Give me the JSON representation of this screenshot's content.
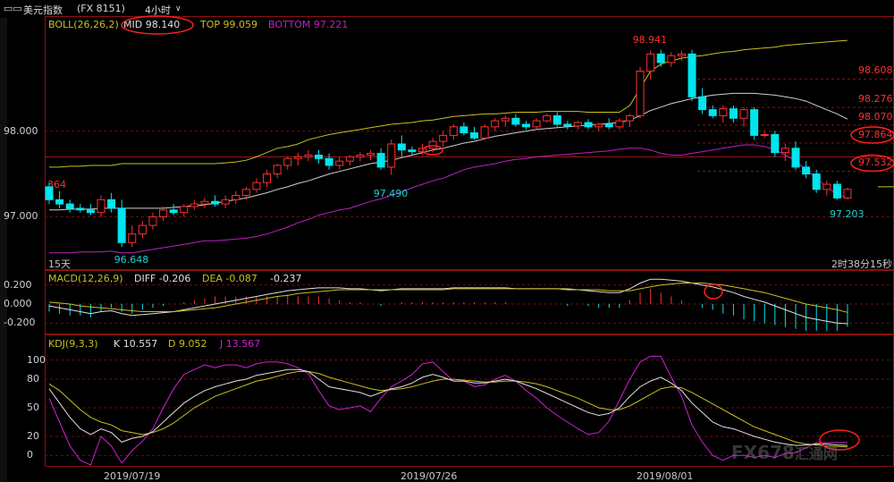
{
  "window": {
    "icon": "chart-window-icon",
    "title": "美元指数",
    "symbol": "(FX 8151)",
    "period": "4小时",
    "period_arrow": "chevron-down-icon"
  },
  "boll": {
    "label": "BOLL(26,26,2)",
    "mid": "MID 98.140",
    "top": "TOP 99.059",
    "bottom": "BOTTOM 97.221"
  },
  "macd": {
    "label": "MACD(12,26,9)",
    "diff": "DIFF -0.206",
    "dea": "DEA -0.087",
    "macd": "-0.237"
  },
  "kdj": {
    "label": "KDJ(9,3,3)",
    "k": "K 10.557",
    "d": "D 9.052",
    "j": "J 13.567"
  },
  "price_panel": {
    "y_ticks": [
      {
        "v": 98.0,
        "label": "98.000"
      },
      {
        "v": 97.0,
        "label": "97.000"
      }
    ],
    "right_levels": [
      {
        "v": 98.608,
        "label": "98.608"
      },
      {
        "v": 98.276,
        "label": "98.276"
      },
      {
        "v": 98.07,
        "label": "98.070"
      },
      {
        "v": 97.86,
        "label": "97.864",
        "circled": true
      },
      {
        "v": 97.532,
        "label": "97.532",
        "circled": true
      }
    ],
    "annotations": [
      {
        "label": "98.941",
        "color": "#ff3030",
        "v": 98.941
      },
      {
        "label": "97.490",
        "color": "#20d0d0",
        "v": 97.49
      },
      {
        "label": "96.648",
        "color": "#20d0d0",
        "v": 96.648
      },
      {
        "label": "97.203",
        "color": "#20d0d0",
        "v": 97.203
      }
    ],
    "left_cut_label": "364",
    "timeframe": "15天",
    "countdown": "2时38分15秒"
  },
  "macd_panel": {
    "y_ticks": [
      "0.200",
      "0.000",
      "-0.200"
    ]
  },
  "kdj_panel": {
    "y_ticks": [
      "100",
      "80",
      "50",
      "20",
      "0"
    ]
  },
  "x_axis": [
    "2019/07/19",
    "2019/07/26",
    "2019/08/01"
  ],
  "watermark": "FX678",
  "watermark_sub": "汇通网",
  "colors": {
    "up": "#ff3030",
    "down": "#00e5ee",
    "mid": "#d0d0d0",
    "top": "#c8c020",
    "bottom": "#c020c0",
    "k": "#e0e0e0",
    "d": "#c8c020",
    "j": "#d020d0",
    "border": "#8a1010"
  },
  "chart_data": {
    "type": "candlestick",
    "title": "美元指数 (FX 8151) 4小时",
    "price": {
      "ylim": [
        96.4,
        99.3
      ],
      "candles": [
        {
          "o": 97.35,
          "h": 97.4,
          "l": 97.15,
          "c": 97.2
        },
        {
          "o": 97.2,
          "h": 97.3,
          "l": 97.1,
          "c": 97.15
        },
        {
          "o": 97.15,
          "h": 97.2,
          "l": 97.05,
          "c": 97.1
        },
        {
          "o": 97.1,
          "h": 97.15,
          "l": 97.05,
          "c": 97.08
        },
        {
          "o": 97.08,
          "h": 97.15,
          "l": 97.02,
          "c": 97.05
        },
        {
          "o": 97.05,
          "h": 97.25,
          "l": 97.0,
          "c": 97.2
        },
        {
          "o": 97.2,
          "h": 97.28,
          "l": 97.05,
          "c": 97.1
        },
        {
          "o": 97.1,
          "h": 97.2,
          "l": 96.65,
          "c": 96.7
        },
        {
          "o": 96.7,
          "h": 96.9,
          "l": 96.648,
          "c": 96.8
        },
        {
          "o": 96.8,
          "h": 96.95,
          "l": 96.75,
          "c": 96.9
        },
        {
          "o": 96.9,
          "h": 97.05,
          "l": 96.85,
          "c": 97.0
        },
        {
          "o": 97.0,
          "h": 97.12,
          "l": 96.95,
          "c": 97.08
        },
        {
          "o": 97.08,
          "h": 97.15,
          "l": 97.02,
          "c": 97.05
        },
        {
          "o": 97.05,
          "h": 97.15,
          "l": 97.0,
          "c": 97.12
        },
        {
          "o": 97.12,
          "h": 97.2,
          "l": 97.08,
          "c": 97.15
        },
        {
          "o": 97.15,
          "h": 97.22,
          "l": 97.1,
          "c": 97.18
        },
        {
          "o": 97.18,
          "h": 97.25,
          "l": 97.12,
          "c": 97.15
        },
        {
          "o": 97.15,
          "h": 97.25,
          "l": 97.1,
          "c": 97.2
        },
        {
          "o": 97.2,
          "h": 97.3,
          "l": 97.15,
          "c": 97.25
        },
        {
          "o": 97.25,
          "h": 97.35,
          "l": 97.2,
          "c": 97.32
        },
        {
          "o": 97.32,
          "h": 97.45,
          "l": 97.28,
          "c": 97.4
        },
        {
          "o": 97.4,
          "h": 97.55,
          "l": 97.35,
          "c": 97.5
        },
        {
          "o": 97.5,
          "h": 97.62,
          "l": 97.45,
          "c": 97.6
        },
        {
          "o": 97.6,
          "h": 97.7,
          "l": 97.55,
          "c": 97.68
        },
        {
          "o": 97.68,
          "h": 97.75,
          "l": 97.6,
          "c": 97.7
        },
        {
          "o": 97.7,
          "h": 97.78,
          "l": 97.65,
          "c": 97.72
        },
        {
          "o": 97.72,
          "h": 97.78,
          "l": 97.62,
          "c": 97.68
        },
        {
          "o": 97.68,
          "h": 97.74,
          "l": 97.55,
          "c": 97.6
        },
        {
          "o": 97.6,
          "h": 97.7,
          "l": 97.55,
          "c": 97.65
        },
        {
          "o": 97.65,
          "h": 97.72,
          "l": 97.6,
          "c": 97.7
        },
        {
          "o": 97.7,
          "h": 97.76,
          "l": 97.65,
          "c": 97.72
        },
        {
          "o": 97.72,
          "h": 97.78,
          "l": 97.66,
          "c": 97.74
        },
        {
          "o": 97.74,
          "h": 97.8,
          "l": 97.55,
          "c": 97.58
        },
        {
          "o": 97.58,
          "h": 97.9,
          "l": 97.49,
          "c": 97.85
        },
        {
          "o": 97.85,
          "h": 97.95,
          "l": 97.7,
          "c": 97.78
        },
        {
          "o": 97.78,
          "h": 97.82,
          "l": 97.72,
          "c": 97.76
        },
        {
          "o": 97.76,
          "h": 97.85,
          "l": 97.72,
          "c": 97.8
        },
        {
          "o": 97.8,
          "h": 97.92,
          "l": 97.75,
          "c": 97.88
        },
        {
          "o": 97.88,
          "h": 98.0,
          "l": 97.82,
          "c": 97.95
        },
        {
          "o": 97.95,
          "h": 98.08,
          "l": 97.9,
          "c": 98.05
        },
        {
          "o": 98.05,
          "h": 98.1,
          "l": 97.95,
          "c": 97.98
        },
        {
          "o": 97.98,
          "h": 98.05,
          "l": 97.9,
          "c": 97.92
        },
        {
          "o": 97.92,
          "h": 98.08,
          "l": 97.9,
          "c": 98.05
        },
        {
          "o": 98.05,
          "h": 98.15,
          "l": 98.0,
          "c": 98.12
        },
        {
          "o": 98.12,
          "h": 98.18,
          "l": 98.05,
          "c": 98.15
        },
        {
          "o": 98.15,
          "h": 98.2,
          "l": 98.05,
          "c": 98.08
        },
        {
          "o": 98.08,
          "h": 98.12,
          "l": 98.02,
          "c": 98.05
        },
        {
          "o": 98.05,
          "h": 98.15,
          "l": 98.02,
          "c": 98.12
        },
        {
          "o": 98.12,
          "h": 98.2,
          "l": 98.1,
          "c": 98.18
        },
        {
          "o": 98.18,
          "h": 98.22,
          "l": 98.05,
          "c": 98.08
        },
        {
          "o": 98.08,
          "h": 98.12,
          "l": 98.02,
          "c": 98.06
        },
        {
          "o": 98.06,
          "h": 98.12,
          "l": 98.02,
          "c": 98.1
        },
        {
          "o": 98.1,
          "h": 98.14,
          "l": 98.02,
          "c": 98.05
        },
        {
          "o": 98.05,
          "h": 98.1,
          "l": 98.0,
          "c": 98.08
        },
        {
          "o": 98.08,
          "h": 98.15,
          "l": 98.02,
          "c": 98.05
        },
        {
          "o": 98.05,
          "h": 98.15,
          "l": 98.02,
          "c": 98.12
        },
        {
          "o": 98.12,
          "h": 98.2,
          "l": 98.05,
          "c": 98.18
        },
        {
          "o": 98.18,
          "h": 98.75,
          "l": 98.15,
          "c": 98.7
        },
        {
          "o": 98.7,
          "h": 98.941,
          "l": 98.6,
          "c": 98.9
        },
        {
          "o": 98.9,
          "h": 98.95,
          "l": 98.75,
          "c": 98.8
        },
        {
          "o": 98.8,
          "h": 98.92,
          "l": 98.75,
          "c": 98.88
        },
        {
          "o": 98.88,
          "h": 98.94,
          "l": 98.82,
          "c": 98.9
        },
        {
          "o": 98.9,
          "h": 98.95,
          "l": 98.35,
          "c": 98.4
        },
        {
          "o": 98.4,
          "h": 98.5,
          "l": 98.2,
          "c": 98.25
        },
        {
          "o": 98.25,
          "h": 98.3,
          "l": 98.15,
          "c": 98.18
        },
        {
          "o": 98.18,
          "h": 98.3,
          "l": 98.1,
          "c": 98.26
        },
        {
          "o": 98.26,
          "h": 98.3,
          "l": 98.1,
          "c": 98.15
        },
        {
          "o": 98.15,
          "h": 98.28,
          "l": 98.05,
          "c": 98.25
        },
        {
          "o": 98.25,
          "h": 98.28,
          "l": 97.9,
          "c": 97.95
        },
        {
          "o": 97.95,
          "h": 98.0,
          "l": 97.92,
          "c": 97.96
        },
        {
          "o": 97.96,
          "h": 98.0,
          "l": 97.7,
          "c": 97.75
        },
        {
          "o": 97.75,
          "h": 97.85,
          "l": 97.65,
          "c": 97.8
        },
        {
          "o": 97.8,
          "h": 97.88,
          "l": 97.55,
          "c": 97.58
        },
        {
          "o": 97.58,
          "h": 97.65,
          "l": 97.45,
          "c": 97.5
        },
        {
          "o": 97.5,
          "h": 97.55,
          "l": 97.28,
          "c": 97.32
        },
        {
          "o": 97.32,
          "h": 97.42,
          "l": 97.25,
          "c": 97.38
        },
        {
          "o": 97.38,
          "h": 97.42,
          "l": 97.2,
          "c": 97.22
        },
        {
          "o": 97.22,
          "h": 97.34,
          "l": 97.203,
          "c": 97.32
        }
      ],
      "boll_top": [
        97.58,
        97.58,
        97.59,
        97.59,
        97.6,
        97.6,
        97.6,
        97.62,
        97.62,
        97.62,
        97.62,
        97.62,
        97.62,
        97.62,
        97.62,
        97.62,
        97.62,
        97.63,
        97.64,
        97.66,
        97.7,
        97.75,
        97.8,
        97.82,
        97.85,
        97.9,
        97.93,
        97.96,
        97.98,
        98.0,
        98.02,
        98.04,
        98.06,
        98.08,
        98.09,
        98.1,
        98.12,
        98.13,
        98.15,
        98.17,
        98.18,
        98.19,
        98.2,
        98.2,
        98.21,
        98.22,
        98.22,
        98.22,
        98.23,
        98.23,
        98.23,
        98.23,
        98.22,
        98.22,
        98.22,
        98.22,
        98.3,
        98.5,
        98.7,
        98.78,
        98.82,
        98.85,
        98.87,
        98.88,
        98.9,
        98.92,
        98.93,
        98.95,
        98.96,
        98.97,
        98.98,
        99.0,
        99.01,
        99.02,
        99.03,
        99.04,
        99.05,
        99.059
      ],
      "boll_mid": [
        97.08,
        97.08,
        97.09,
        97.09,
        97.09,
        97.1,
        97.1,
        97.1,
        97.1,
        97.1,
        97.1,
        97.1,
        97.11,
        97.12,
        97.13,
        97.14,
        97.16,
        97.18,
        97.2,
        97.22,
        97.25,
        97.28,
        97.32,
        97.35,
        97.39,
        97.42,
        97.46,
        97.5,
        97.53,
        97.56,
        97.59,
        97.62,
        97.64,
        97.66,
        97.69,
        97.72,
        97.75,
        97.78,
        97.8,
        97.83,
        97.86,
        97.88,
        97.91,
        97.94,
        97.96,
        97.98,
        98.0,
        98.02,
        98.03,
        98.04,
        98.05,
        98.06,
        98.07,
        98.08,
        98.09,
        98.1,
        98.13,
        98.18,
        98.24,
        98.28,
        98.32,
        98.35,
        98.38,
        98.4,
        98.42,
        98.43,
        98.44,
        98.44,
        98.44,
        98.43,
        98.42,
        98.4,
        98.38,
        98.35,
        98.3,
        98.25,
        98.2,
        98.14
      ],
      "boll_bottom": [
        96.58,
        96.58,
        96.58,
        96.59,
        96.59,
        96.59,
        96.6,
        96.58,
        96.58,
        96.6,
        96.62,
        96.64,
        96.66,
        96.68,
        96.7,
        96.72,
        96.72,
        96.73,
        96.74,
        96.75,
        96.77,
        96.8,
        96.84,
        96.88,
        96.93,
        96.97,
        97.02,
        97.05,
        97.08,
        97.1,
        97.14,
        97.18,
        97.21,
        97.25,
        97.29,
        97.34,
        97.38,
        97.42,
        97.45,
        97.5,
        97.55,
        97.58,
        97.6,
        97.62,
        97.65,
        97.67,
        97.68,
        97.7,
        97.71,
        97.72,
        97.73,
        97.74,
        97.75,
        97.76,
        97.77,
        97.79,
        97.8,
        97.8,
        97.78,
        97.74,
        97.72,
        97.72,
        97.74,
        97.76,
        97.78,
        97.8,
        97.82,
        97.84,
        97.84,
        97.82,
        97.78,
        97.72,
        97.65,
        97.55,
        97.45,
        97.35,
        97.26,
        97.221
      ]
    },
    "macd": {
      "ylim": [
        -0.3,
        0.3
      ],
      "diff": [
        -0.02,
        -0.04,
        -0.06,
        -0.08,
        -0.1,
        -0.08,
        -0.07,
        -0.1,
        -0.12,
        -0.11,
        -0.1,
        -0.09,
        -0.08,
        -0.06,
        -0.04,
        -0.02,
        0.0,
        0.02,
        0.04,
        0.06,
        0.08,
        0.1,
        0.12,
        0.14,
        0.15,
        0.16,
        0.17,
        0.17,
        0.17,
        0.16,
        0.16,
        0.15,
        0.14,
        0.15,
        0.16,
        0.16,
        0.16,
        0.16,
        0.16,
        0.17,
        0.17,
        0.17,
        0.17,
        0.17,
        0.17,
        0.16,
        0.16,
        0.16,
        0.16,
        0.16,
        0.15,
        0.15,
        0.14,
        0.13,
        0.12,
        0.12,
        0.16,
        0.22,
        0.26,
        0.26,
        0.25,
        0.24,
        0.22,
        0.2,
        0.18,
        0.15,
        0.12,
        0.08,
        0.05,
        0.02,
        -0.02,
        -0.06,
        -0.1,
        -0.14,
        -0.16,
        -0.18,
        -0.2,
        -0.206
      ],
      "dea": [
        0.02,
        0.01,
        0.0,
        -0.02,
        -0.03,
        -0.04,
        -0.05,
        -0.06,
        -0.07,
        -0.08,
        -0.08,
        -0.08,
        -0.08,
        -0.07,
        -0.06,
        -0.05,
        -0.04,
        -0.02,
        0.0,
        0.02,
        0.04,
        0.06,
        0.08,
        0.09,
        0.11,
        0.12,
        0.13,
        0.14,
        0.15,
        0.15,
        0.15,
        0.15,
        0.15,
        0.15,
        0.15,
        0.15,
        0.15,
        0.15,
        0.15,
        0.16,
        0.16,
        0.16,
        0.16,
        0.16,
        0.16,
        0.16,
        0.16,
        0.16,
        0.16,
        0.16,
        0.16,
        0.15,
        0.15,
        0.15,
        0.14,
        0.14,
        0.14,
        0.16,
        0.18,
        0.2,
        0.21,
        0.22,
        0.22,
        0.22,
        0.21,
        0.2,
        0.18,
        0.16,
        0.14,
        0.12,
        0.09,
        0.06,
        0.03,
        0.0,
        -0.02,
        -0.04,
        -0.06,
        -0.087
      ]
    },
    "kdj": {
      "ylim": [
        -10,
        110
      ],
      "k": [
        70,
        55,
        40,
        28,
        22,
        28,
        24,
        14,
        18,
        20,
        25,
        35,
        45,
        55,
        62,
        68,
        72,
        75,
        78,
        80,
        84,
        86,
        88,
        90,
        90,
        88,
        80,
        72,
        70,
        68,
        66,
        62,
        66,
        70,
        72,
        76,
        82,
        85,
        82,
        78,
        78,
        76,
        76,
        78,
        80,
        78,
        74,
        70,
        65,
        60,
        55,
        50,
        45,
        42,
        44,
        50,
        62,
        72,
        78,
        82,
        76,
        68,
        55,
        45,
        35,
        30,
        28,
        24,
        20,
        17,
        14,
        12,
        10.557,
        11,
        12,
        12,
        11,
        10.557
      ],
      "d": [
        75,
        68,
        58,
        48,
        40,
        35,
        32,
        26,
        24,
        22,
        24,
        28,
        34,
        42,
        50,
        56,
        62,
        66,
        70,
        74,
        78,
        80,
        83,
        86,
        88,
        88,
        86,
        82,
        79,
        76,
        73,
        70,
        68,
        69,
        70,
        72,
        75,
        78,
        80,
        80,
        79,
        78,
        77,
        77,
        78,
        78,
        77,
        75,
        72,
        68,
        64,
        60,
        55,
        50,
        48,
        48,
        52,
        58,
        64,
        70,
        72,
        71,
        66,
        60,
        54,
        48,
        42,
        36,
        30,
        26,
        22,
        18,
        14,
        12,
        11,
        10,
        9.5,
        9.052
      ],
      "j": [
        60,
        35,
        10,
        -5,
        -10,
        20,
        10,
        -8,
        5,
        15,
        28,
        50,
        70,
        85,
        90,
        95,
        92,
        95,
        95,
        92,
        96,
        98,
        98,
        96,
        92,
        86,
        68,
        52,
        48,
        50,
        52,
        46,
        60,
        72,
        78,
        85,
        96,
        98,
        88,
        78,
        78,
        72,
        74,
        80,
        84,
        78,
        68,
        60,
        50,
        42,
        35,
        28,
        22,
        24,
        36,
        58,
        80,
        98,
        104,
        104,
        82,
        62,
        32,
        14,
        0,
        -5,
        0,
        0,
        -2,
        0,
        -2,
        2,
        3,
        8,
        13.567,
        13.567,
        13.567,
        13.567
      ]
    }
  }
}
